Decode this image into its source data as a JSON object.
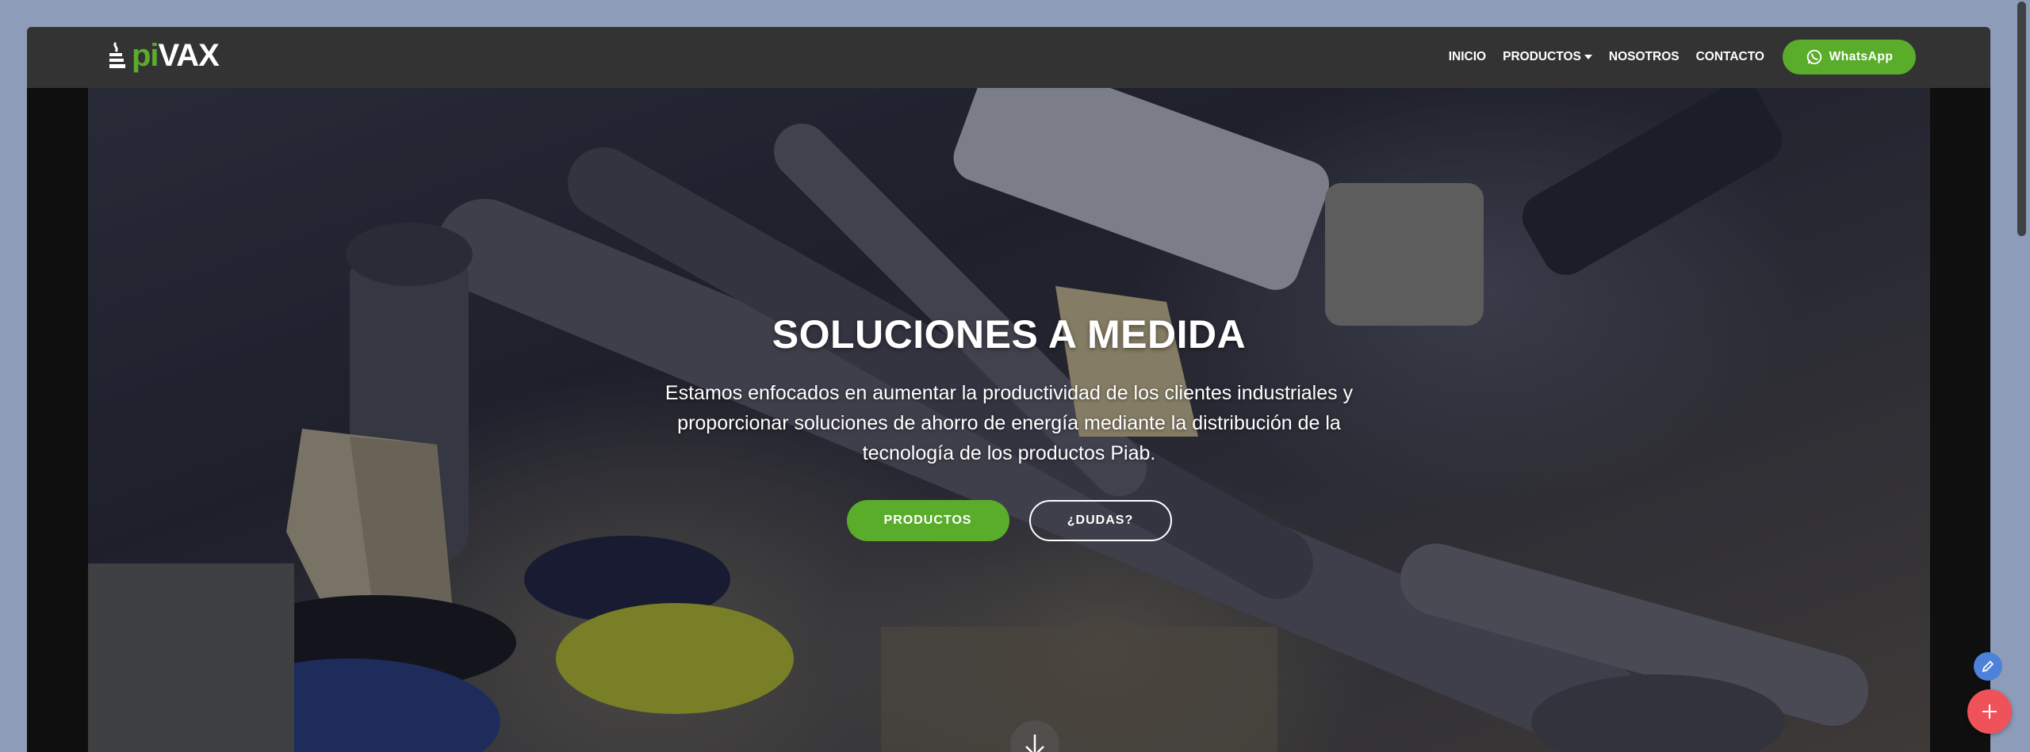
{
  "nav": {
    "logo": {
      "part1": "pi",
      "part2": "VAX"
    },
    "links": [
      "INICIO",
      "PRODUCTOS",
      "NOSOTROS",
      "CONTACTO"
    ],
    "whatsapp_label": "WhatsApp"
  },
  "hero": {
    "title": "SOLUCIONES A MEDIDA",
    "text": "Estamos enfocados en aumentar la productividad de los clientes industriales y proporcionar soluciones de ahorro de energía mediante la distribución de la tecnología de los productos Piab.",
    "primary_button": "PRODUCTOS",
    "secondary_button": "¿DUDAS?"
  },
  "colors": {
    "brand_green": "#5aad2b",
    "navbar": "#333333",
    "fab_red": "#f0525a",
    "fab_blue": "#4c82d9"
  },
  "icons": {
    "whatsapp": "whatsapp-icon",
    "scroll": "arrow-down-icon",
    "edit": "pencil-icon",
    "add": "plus-icon"
  }
}
